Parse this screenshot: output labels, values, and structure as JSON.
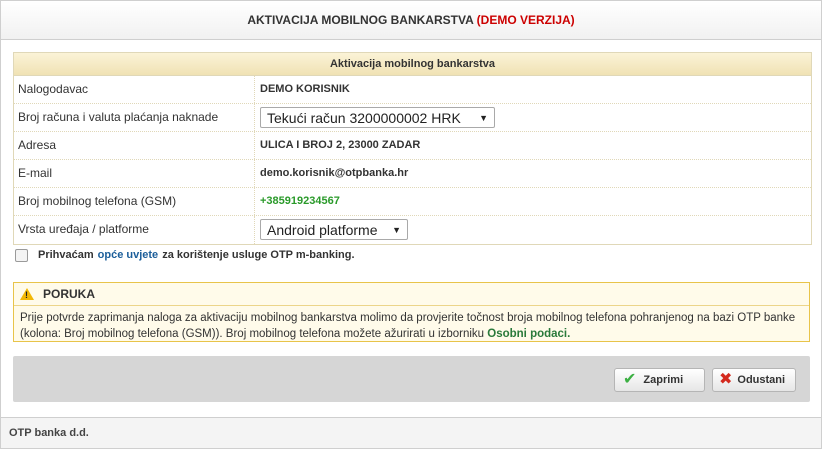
{
  "dialog": {
    "title": "AKTIVACIJA MOBILNOG BANKARSTVA",
    "title_demo": "(DEMO VERZIJA)"
  },
  "form": {
    "header": "Aktivacija mobilnog bankarstva",
    "rows": [
      {
        "label": "Nalogodavac",
        "value": "DEMO KORISNIK"
      },
      {
        "label": "Broj računa i valuta plaćanja naknade",
        "value": "Tekući račun 3200000002  HRK"
      },
      {
        "label": "Adresa",
        "value": "ULICA I BROJ 2, 23000 ZADAR"
      },
      {
        "label": "E-mail",
        "value": "demo.korisnik@otpbanka.hr"
      },
      {
        "label": "Broj mobilnog telefona (GSM)",
        "value": "+385919234567"
      },
      {
        "label": "Vrsta uređaja / platforme",
        "value": "Android platforme"
      }
    ]
  },
  "accept": {
    "text_before": "Prihvaćam",
    "link": "opće uvjete",
    "text_after": "za korištenje usluge OTP m-banking."
  },
  "notice": {
    "title": "PORUKA",
    "body": "Prije potvrde zaprimanja naloga za aktivaciju mobilnog bankarstva molimo da provjerite točnost broja mobilnog telefona pohranjenog na bazi OTP banke (kolona: Broj mobilnog telefona (GSM)). Broj mobilnog telefona možete ažurirati u izborniku",
    "link": "Osobni podaci."
  },
  "buttons": {
    "confirm": "Zaprimi",
    "cancel": "Odustani"
  },
  "footer": {
    "text": "OTP banka d.d."
  },
  "icons": {
    "warning": "warning-triangle-icon",
    "confirm": "check-icon",
    "cancel": "x-icon"
  },
  "colors": {
    "demo": "#cc0000",
    "phone": "#2a9a2a",
    "link": "#1b5e9a",
    "notice_border": "#e8c44a"
  }
}
